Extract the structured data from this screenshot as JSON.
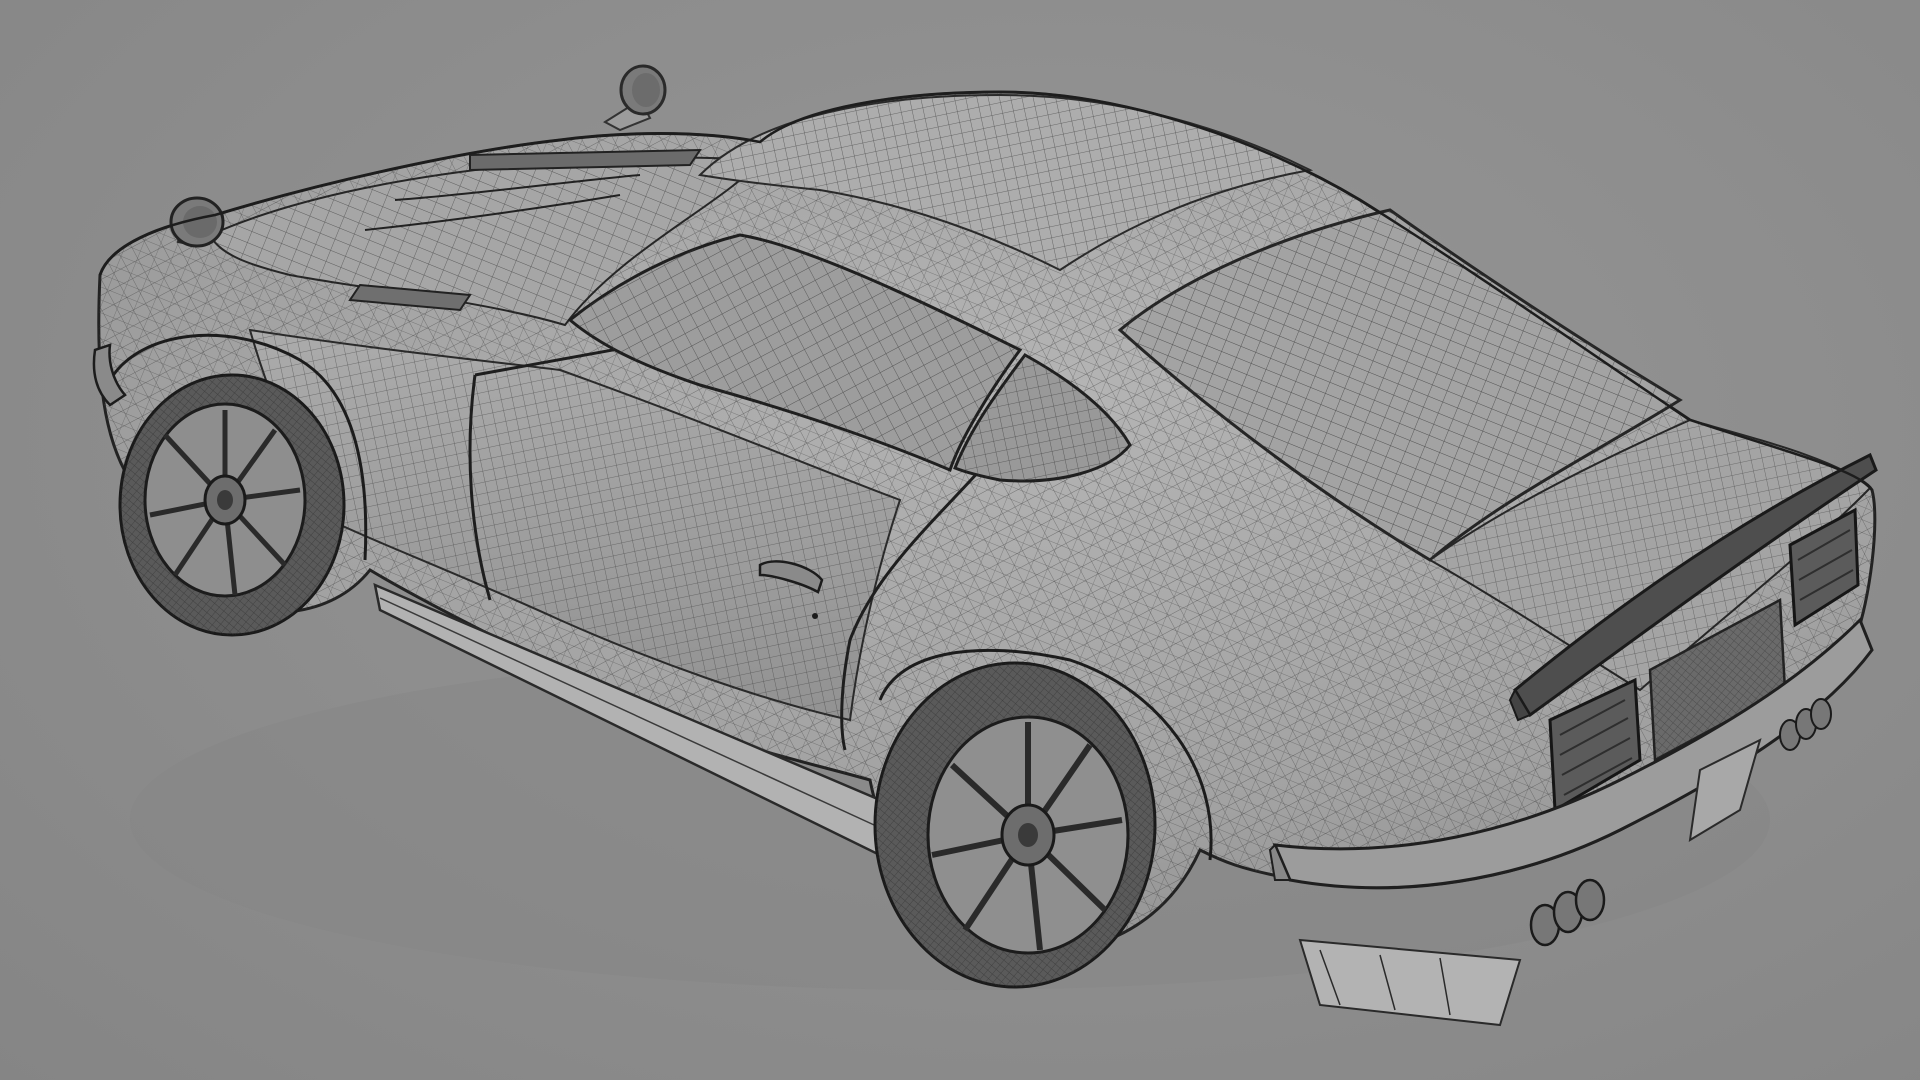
{
  "scene": {
    "subject": "car-wireframe-model",
    "background_color": "#8c8c8c",
    "wire_color": "#3a3a3a",
    "surface_color": "#a9a9a9",
    "glass_color": "#9a9a9a",
    "shadow_color": "#7a7a7a"
  }
}
